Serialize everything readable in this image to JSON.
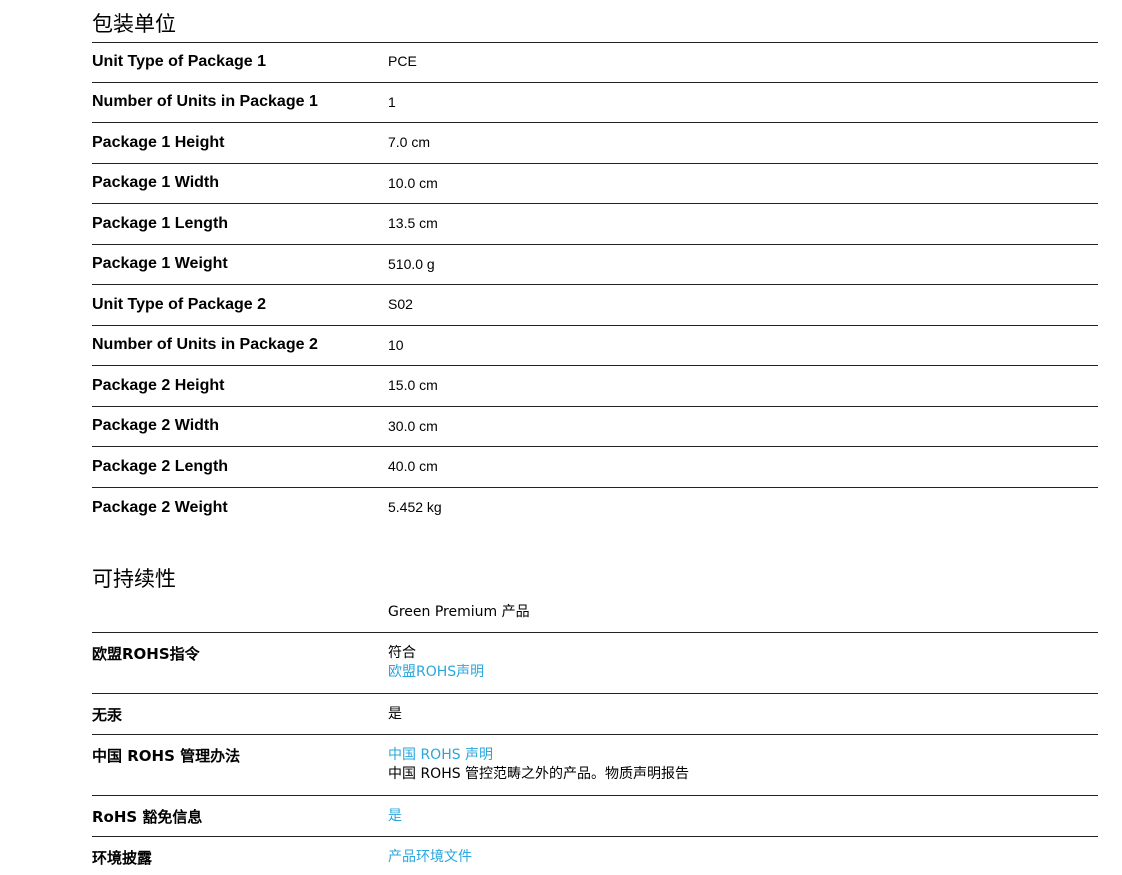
{
  "packaging": {
    "title": "包装单位",
    "rows": [
      {
        "label": "Unit Type of Package 1",
        "value": "PCE"
      },
      {
        "label": "Number of Units in Package 1",
        "value": "1"
      },
      {
        "label": "Package 1 Height",
        "value": "7.0 cm"
      },
      {
        "label": "Package 1 Width",
        "value": "10.0 cm"
      },
      {
        "label": "Package 1 Length",
        "value": "13.5 cm"
      },
      {
        "label": "Package 1 Weight",
        "value": "510.0 g"
      },
      {
        "label": "Unit Type of Package 2",
        "value": "S02"
      },
      {
        "label": "Number of Units in Package 2",
        "value": "10"
      },
      {
        "label": "Package 2 Height",
        "value": "15.0 cm"
      },
      {
        "label": "Package 2 Width",
        "value": "30.0 cm"
      },
      {
        "label": "Package 2 Length",
        "value": "40.0 cm"
      },
      {
        "label": "Package 2 Weight",
        "value": "5.452 kg"
      }
    ]
  },
  "sustainability": {
    "title": "可持续性",
    "rows": [
      {
        "label": "",
        "value": "Green Premium 产品"
      },
      {
        "label": "欧盟ROHS指令",
        "value": "符合",
        "link": "欧盟ROHS声明"
      },
      {
        "label": "无汞",
        "value": "是"
      },
      {
        "label": "中国 ROHS 管理办法",
        "link": "中国 ROHS 声明",
        "value": "中国 ROHS 管控范畴之外的产品。物质声明报告"
      },
      {
        "label": "RoHS 豁免信息",
        "link": "是"
      },
      {
        "label": "环境披露",
        "link": "产品环境文件"
      }
    ]
  },
  "colors": {
    "link": "#2aa6dd",
    "rule": "#222222"
  }
}
